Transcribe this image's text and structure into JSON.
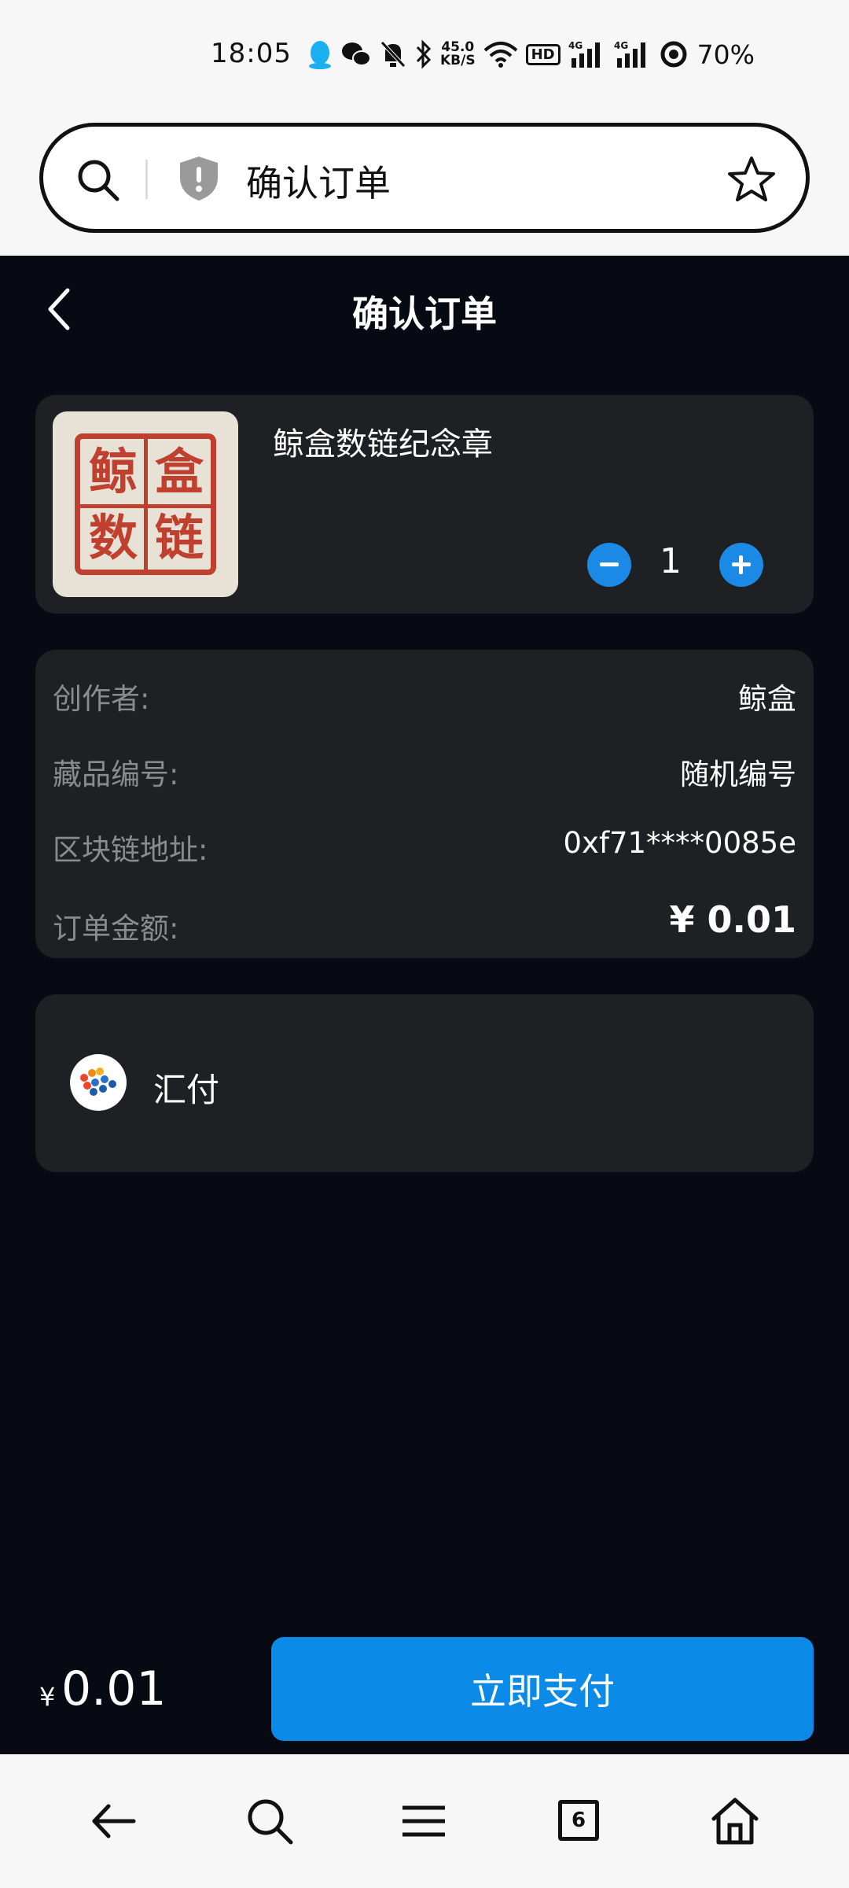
{
  "status_bar": {
    "time": "18:05",
    "net_speed_value": "45.0",
    "net_speed_unit": "KB/S",
    "hd_label": "HD",
    "signal_1": "4G",
    "signal_2": "4G",
    "battery": "70%",
    "icons": [
      "qq-icon",
      "wechat-icon",
      "mute-icon",
      "bluetooth-icon",
      "wifi-icon",
      "hd-icon",
      "signal-icon",
      "battery-icon"
    ]
  },
  "address_bar": {
    "title": "确认订单"
  },
  "header": {
    "title": "确认订单"
  },
  "product": {
    "seal_chars": [
      "鲸",
      "盒",
      "数",
      "链"
    ],
    "name": "鲸盒数链纪念章",
    "quantity": "1"
  },
  "info": {
    "rows": [
      {
        "label": "创作者:",
        "value": "鲸盒"
      },
      {
        "label": "藏品编号:",
        "value": "随机编号"
      },
      {
        "label": "区块链地址:",
        "value": "0xf71****0085e"
      },
      {
        "label": "订单金额:",
        "value": "¥ 0.01"
      }
    ]
  },
  "payment": {
    "method": "汇付"
  },
  "footer": {
    "currency": "¥",
    "total": "0.01",
    "pay_button": "立即支付"
  },
  "bottom_nav": {
    "tab_count": "6"
  },
  "colors": {
    "background": "#070a12",
    "card": "#1f2023",
    "accent": "#0b8ae8",
    "seal_red": "#c04030"
  }
}
